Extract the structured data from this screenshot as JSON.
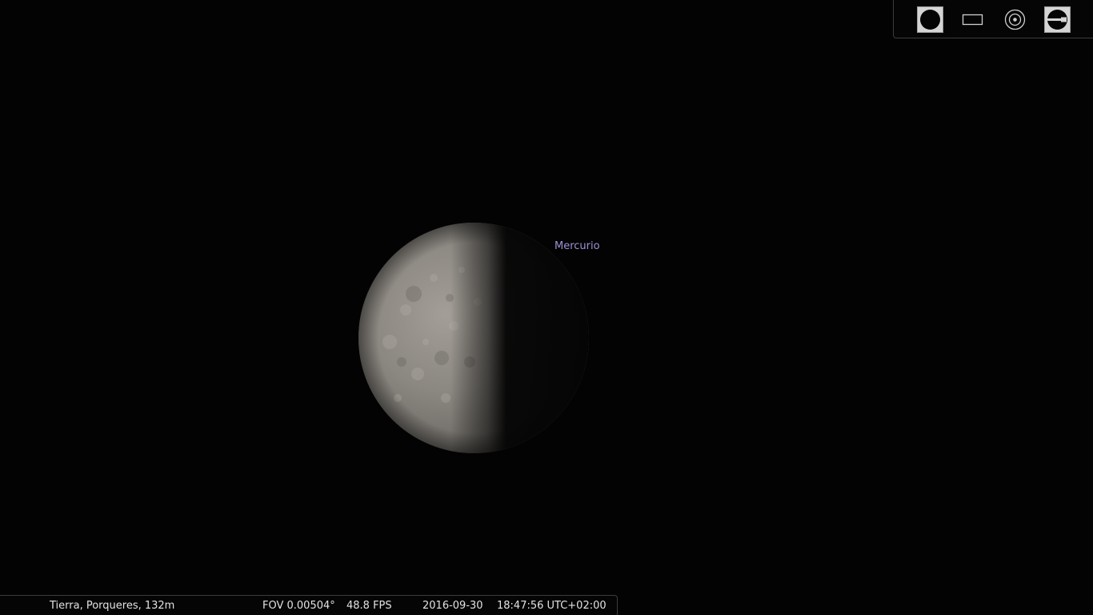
{
  "sky": {
    "object_label": "Mercurio"
  },
  "toolbar": {
    "buttons": [
      {
        "icon": "planet-disc-icon",
        "active": true
      },
      {
        "icon": "rectangle-icon",
        "active": false
      },
      {
        "icon": "target-circle-icon",
        "active": false
      },
      {
        "icon": "ocular-icon",
        "active": true
      }
    ]
  },
  "status": {
    "location": "Tierra, Porqueres, 132m",
    "fov": "FOV 0.00504°",
    "fps": "48.8 FPS",
    "date": "2016-09-30",
    "time": "18:47:56 UTC+02:00"
  },
  "colors": {
    "background": "#030303",
    "label": "#9a93d6",
    "status_text": "#e2e2e2",
    "button_active": "#d5d5d5"
  }
}
